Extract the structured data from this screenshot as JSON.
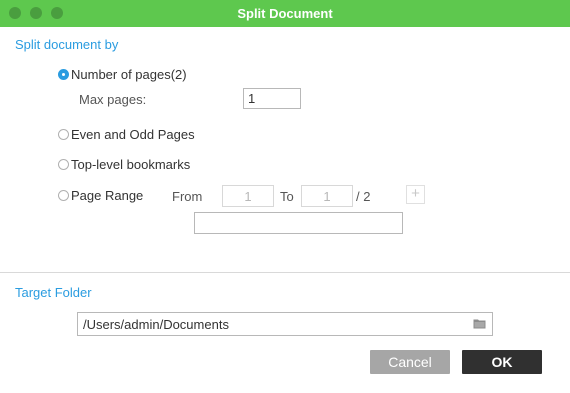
{
  "window": {
    "title": "Split Document"
  },
  "split_section": {
    "heading": "Split document by",
    "options": [
      {
        "label": "Number of pages(2)",
        "selected": true
      },
      {
        "label": "Even and Odd Pages",
        "selected": false
      },
      {
        "label": "Top-level bookmarks",
        "selected": false
      },
      {
        "label": "Page Range",
        "selected": false
      }
    ],
    "max_pages_label": "Max pages:",
    "max_pages_value": "1",
    "range": {
      "from_label": "From",
      "from_value": "1",
      "to_label": "To",
      "to_value": "1",
      "total": "/ 2",
      "add_glyph": "+",
      "custom_value": ""
    }
  },
  "target_section": {
    "heading": "Target Folder",
    "path": "/Users/admin/Documents",
    "browse_icon": "folder-icon"
  },
  "buttons": {
    "cancel": "Cancel",
    "ok": "OK"
  },
  "colors": {
    "titlebar": "#5ec84e",
    "accent": "#2a9ce0",
    "ok_button": "#303030",
    "cancel_button": "#a6a6a6"
  }
}
